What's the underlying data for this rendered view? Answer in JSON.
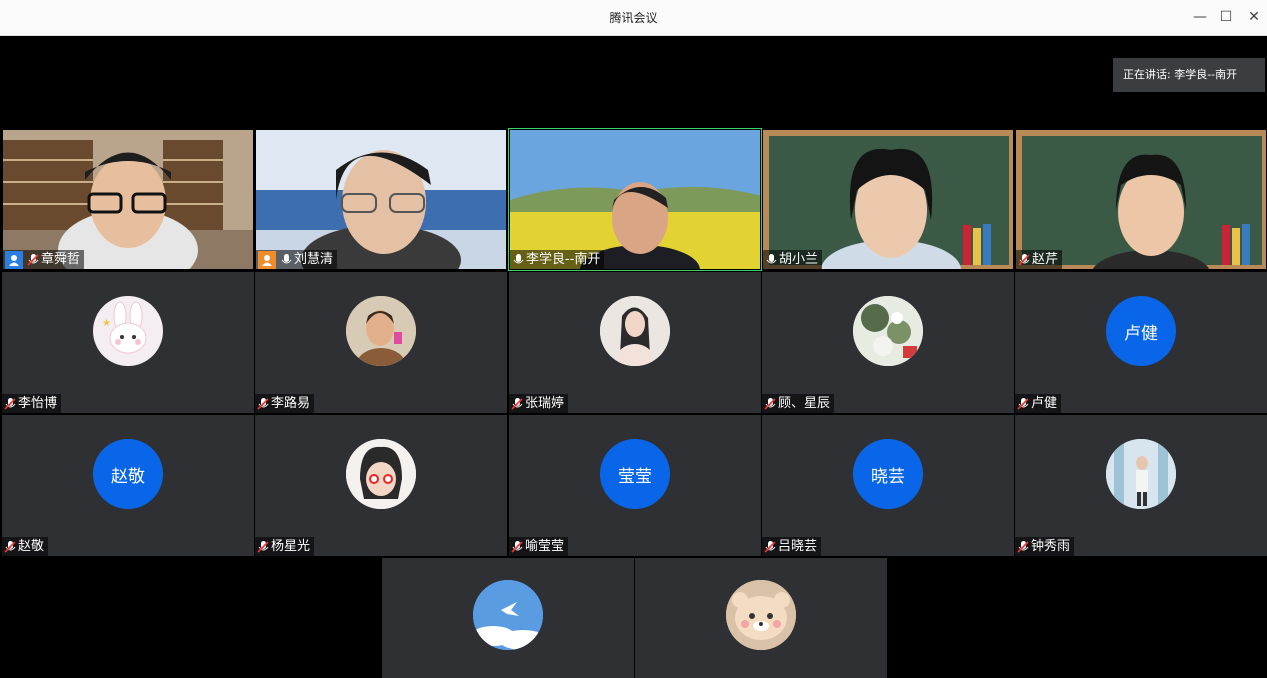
{
  "window": {
    "title": "腾讯会议"
  },
  "speaking": {
    "text": "正在讲话: 李学良--南开"
  },
  "video_row": [
    {
      "name": "章舜哲",
      "role": "host"
    },
    {
      "name": "刘慧清",
      "role": "cohost"
    },
    {
      "name": "李学良--南开",
      "role": ""
    },
    {
      "name": "胡小兰",
      "role": ""
    },
    {
      "name": "赵芹",
      "role": ""
    }
  ],
  "row2": [
    {
      "name": "李怡博",
      "avatar": "bunny-avatar"
    },
    {
      "name": "李路易",
      "avatar": "photo-avatar"
    },
    {
      "name": "张瑞婷",
      "avatar": "photo-avatar"
    },
    {
      "name": "顾、星辰",
      "avatar": "photo-avatar"
    },
    {
      "name": "卢健",
      "avatar_text": "卢健"
    }
  ],
  "row3": [
    {
      "name": "赵敬",
      "avatar_text": "赵敬"
    },
    {
      "name": "杨星光",
      "avatar": "cartoon-avatar"
    },
    {
      "name": "喻莹莹",
      "avatar_text": "莹莹"
    },
    {
      "name": "吕晓芸",
      "avatar_text": "晓芸"
    },
    {
      "name": "钟秀雨",
      "avatar": "photo-avatar"
    }
  ],
  "row4": [
    {
      "avatar": "sky-avatar"
    },
    {
      "avatar": "bear-avatar"
    }
  ],
  "colors": {
    "avatar_blue": "#0a66e8",
    "tile_bg": "#2f3033",
    "active_border": "#3ad06b",
    "host_badge": "#2a7de1",
    "cohost_badge": "#f08c2a"
  }
}
